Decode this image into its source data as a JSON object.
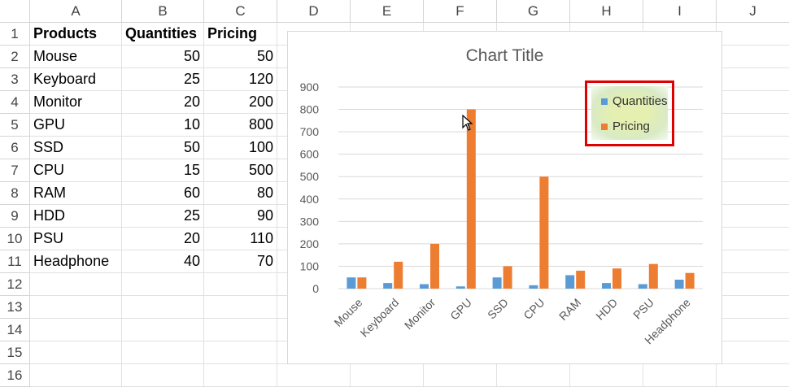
{
  "columns": [
    "A",
    "B",
    "C",
    "D",
    "E",
    "F",
    "G",
    "H",
    "I",
    "J"
  ],
  "rows": [
    "1",
    "2",
    "3",
    "4",
    "5",
    "6",
    "7",
    "8",
    "9",
    "10",
    "11",
    "12",
    "13",
    "14",
    "15",
    "16"
  ],
  "table": {
    "headers": [
      "Products",
      "Quantities",
      "Pricing"
    ],
    "data": [
      [
        "Mouse",
        "50",
        "50"
      ],
      [
        "Keyboard",
        "25",
        "120"
      ],
      [
        "Monitor",
        "20",
        "200"
      ],
      [
        "GPU",
        "10",
        "800"
      ],
      [
        "SSD",
        "50",
        "100"
      ],
      [
        "CPU",
        "15",
        "500"
      ],
      [
        "RAM",
        "60",
        "80"
      ],
      [
        "HDD",
        "25",
        "90"
      ],
      [
        "PSU",
        "20",
        "110"
      ],
      [
        "Headphone",
        "40",
        "70"
      ]
    ]
  },
  "chart_data": {
    "type": "bar",
    "title": "Chart Title",
    "categories": [
      "Mouse",
      "Keyboard",
      "Monitor",
      "GPU",
      "SSD",
      "CPU",
      "RAM",
      "HDD",
      "PSU",
      "Headphone"
    ],
    "series": [
      {
        "name": "Quantities",
        "values": [
          50,
          25,
          20,
          10,
          50,
          15,
          60,
          25,
          20,
          40
        ],
        "color": "#5b9bd5"
      },
      {
        "name": "Pricing",
        "values": [
          50,
          120,
          200,
          800,
          100,
          500,
          80,
          90,
          110,
          70
        ],
        "color": "#ed7d31"
      }
    ],
    "ylim": [
      0,
      900
    ],
    "yticks": [
      "0",
      "100",
      "200",
      "300",
      "400",
      "500",
      "600",
      "700",
      "800",
      "900"
    ],
    "grid": true,
    "legend_position": "top-right",
    "legend_highlight_color": "#e00000"
  }
}
